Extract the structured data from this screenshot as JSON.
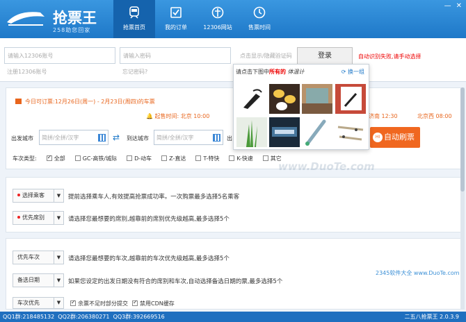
{
  "app": {
    "title": "抢票王",
    "slogan": "258助您回家"
  },
  "nav": [
    {
      "label": "抢票首页"
    },
    {
      "label": "我的订单"
    },
    {
      "label": "12306网站"
    },
    {
      "label": "售票时间"
    }
  ],
  "window": {
    "min": "—",
    "close": "✕"
  },
  "login": {
    "username_placeholder": "请输入12306账号",
    "password_placeholder": "请输入密码",
    "captcha_placeholder": "点击显示/隐藏验证码",
    "register": "注册12306账号",
    "forgot": "忘记密码?",
    "button": "登录",
    "auto_fail": "自动识别失败,请手动选择"
  },
  "captcha": {
    "prompt_pre": "请点击下图中",
    "prompt_red": "所有的",
    "word": "体温计",
    "refresh": "换一组"
  },
  "booking": {
    "today_pre": "今日可订票:",
    "today_range": "12月26日(周一) - 2月23日(周四)",
    "today_suf": "的车票",
    "start_time": "起售时间: 北京 10:00",
    "other_station1": "济南 12:30",
    "other_station2": "北京西 08:00",
    "from_label": "出发城市",
    "to_label": "到达城市",
    "from_placeholder": "简拼/全拼/汉字",
    "to_placeholder": "简拼/全拼/汉字",
    "date_label": "出",
    "auto_button": "自动刷票",
    "auto_icon": "HI",
    "type_label": "车次类型:",
    "types": [
      "全部",
      "GC-高铁/城际",
      "D-动车",
      "Z-直达",
      "T-特快",
      "K-快速",
      "其它"
    ]
  },
  "settings": {
    "select_passenger": "选择乘客",
    "passenger_desc": "提前选择乘车人,有效提高抢票成功率。一次购票最多选择5名乘客",
    "priority_seat": "优先席别",
    "seat_desc": "请选择您最想要的席别,越靠前的席别优先级越高,最多选择5个",
    "priority_train": "优先车次",
    "train_desc": "请选择您最想要的车次,越靠前的车次优先级越高,最多选择5个",
    "backup_date": "备选日期",
    "date_desc": "如果您设定的出发日期没有符合的席别和车次,自动选择备选日期的票,最多选择5个",
    "train_first": "车次优先",
    "partial_submit": "余票不足时部分提交",
    "disable_cdn": "禁用CDN缓存"
  },
  "watermark": "www.DuoTe.com",
  "corner_brand": "2345软件大全 www.DuoTe.com",
  "status": {
    "qq1": "QQ1群:218485132",
    "qq2": "QQ2群:206380271",
    "qq3": "QQ3群:392669516",
    "version": "二五八抢票王 2.0.3.9"
  },
  "colors": {
    "header": "#1e78c8",
    "accent": "#f0671f",
    "alert": "#e00000"
  }
}
